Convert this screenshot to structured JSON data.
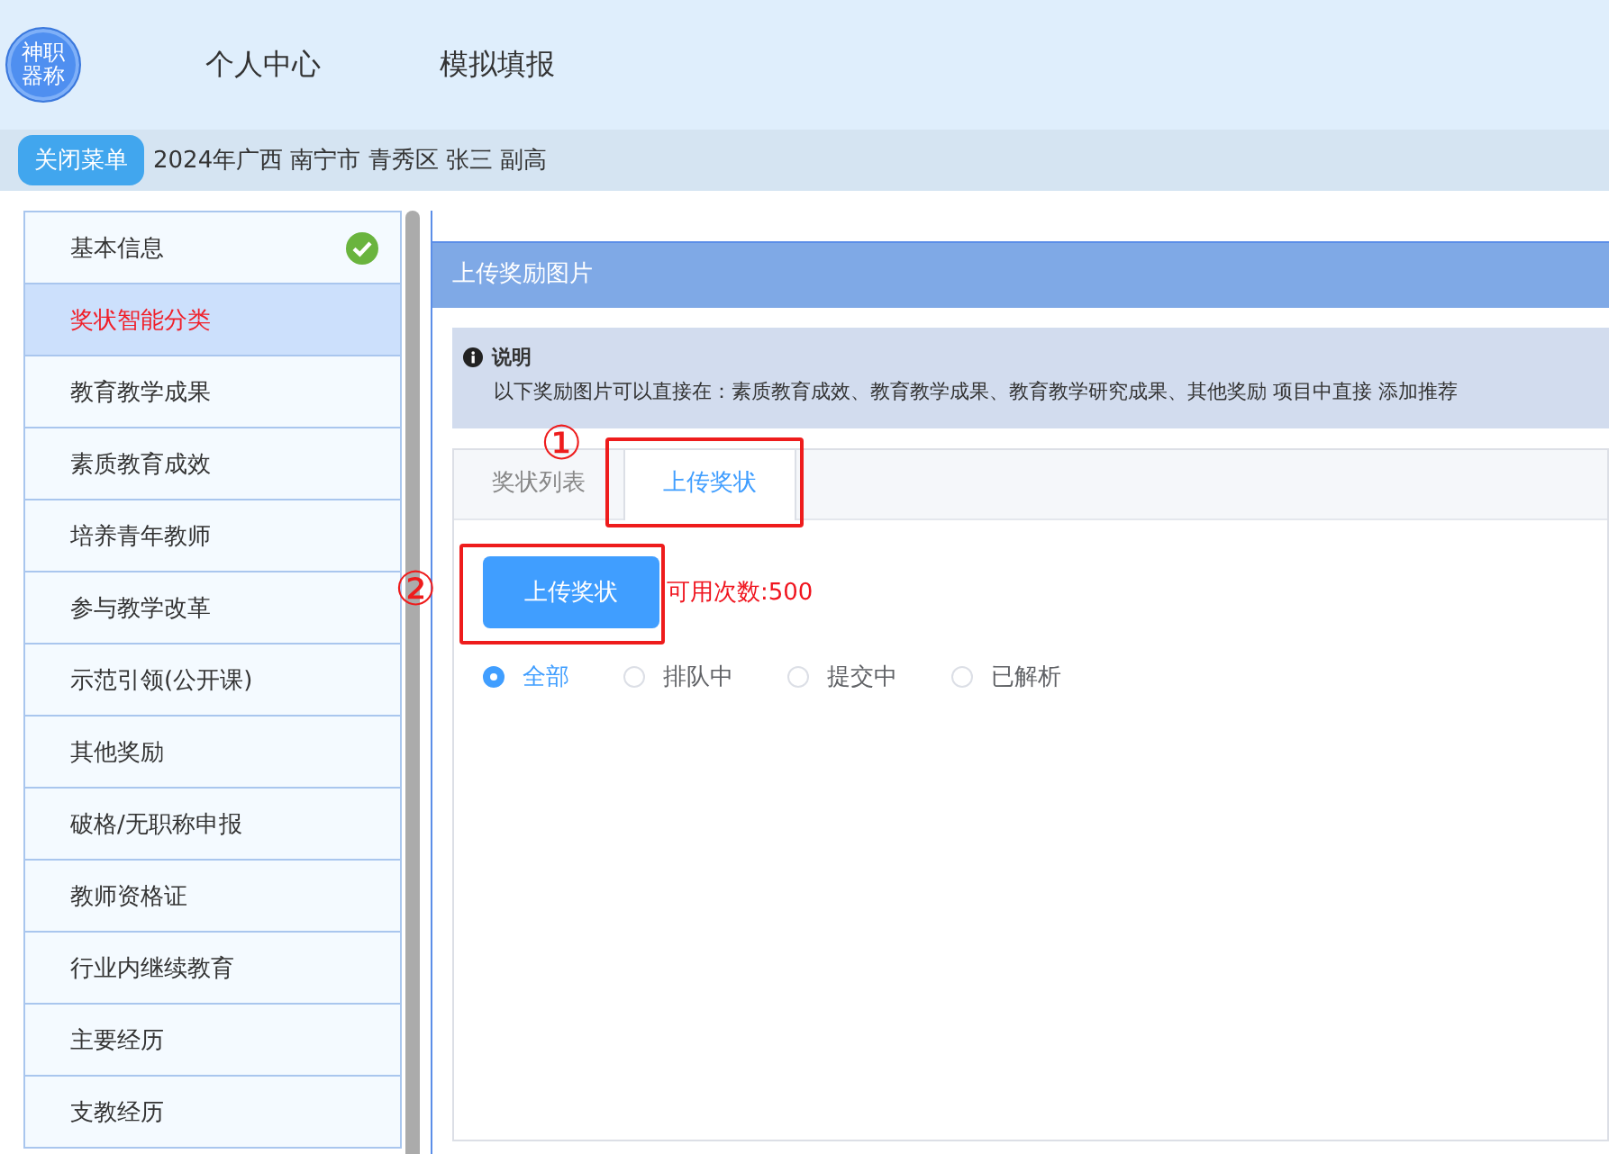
{
  "logo": {
    "lines": [
      "神职",
      "器称"
    ]
  },
  "nav": [
    {
      "label": "个人中心"
    },
    {
      "label": "模拟填报"
    }
  ],
  "subbar": {
    "button": "关闭菜单",
    "info": "2024年广西 南宁市 青秀区 张三 副高"
  },
  "sidebar": {
    "items": [
      {
        "label": "基本信息",
        "selected": false,
        "done": true
      },
      {
        "label": "奖状智能分类",
        "selected": true,
        "done": false
      },
      {
        "label": "教育教学成果",
        "selected": false,
        "done": false
      },
      {
        "label": "素质教育成效",
        "selected": false,
        "done": false
      },
      {
        "label": "培养青年教师",
        "selected": false,
        "done": false
      },
      {
        "label": "参与教学改革",
        "selected": false,
        "done": false
      },
      {
        "label": "示范引领(公开课)",
        "selected": false,
        "done": false
      },
      {
        "label": "其他奖励",
        "selected": false,
        "done": false
      },
      {
        "label": "破格/无职称申报",
        "selected": false,
        "done": false
      },
      {
        "label": "教师资格证",
        "selected": false,
        "done": false
      },
      {
        "label": "行业内继续教育",
        "selected": false,
        "done": false
      },
      {
        "label": "主要经历",
        "selected": false,
        "done": false
      },
      {
        "label": "支教经历",
        "selected": false,
        "done": false
      }
    ]
  },
  "panel": {
    "title": "上传奖励图片",
    "notice": {
      "title": "说明",
      "text": "以下奖励图片可以直接在：素质教育成效、教育教学成果、教育教学研究成果、其他奖励 项目中直接 添加推荐"
    },
    "tabs": [
      {
        "label": "奖状列表",
        "selected": false
      },
      {
        "label": "上传奖状",
        "selected": true
      }
    ],
    "upload_button": "上传奖状",
    "quota": "可用次数:500",
    "filters": [
      {
        "label": "全部",
        "selected": true
      },
      {
        "label": "排队中",
        "selected": false
      },
      {
        "label": "提交中",
        "selected": false
      },
      {
        "label": "已解析",
        "selected": false
      }
    ]
  },
  "annotations": [
    {
      "number": "①",
      "kind": "tab"
    },
    {
      "number": "②",
      "kind": "button"
    }
  ]
}
